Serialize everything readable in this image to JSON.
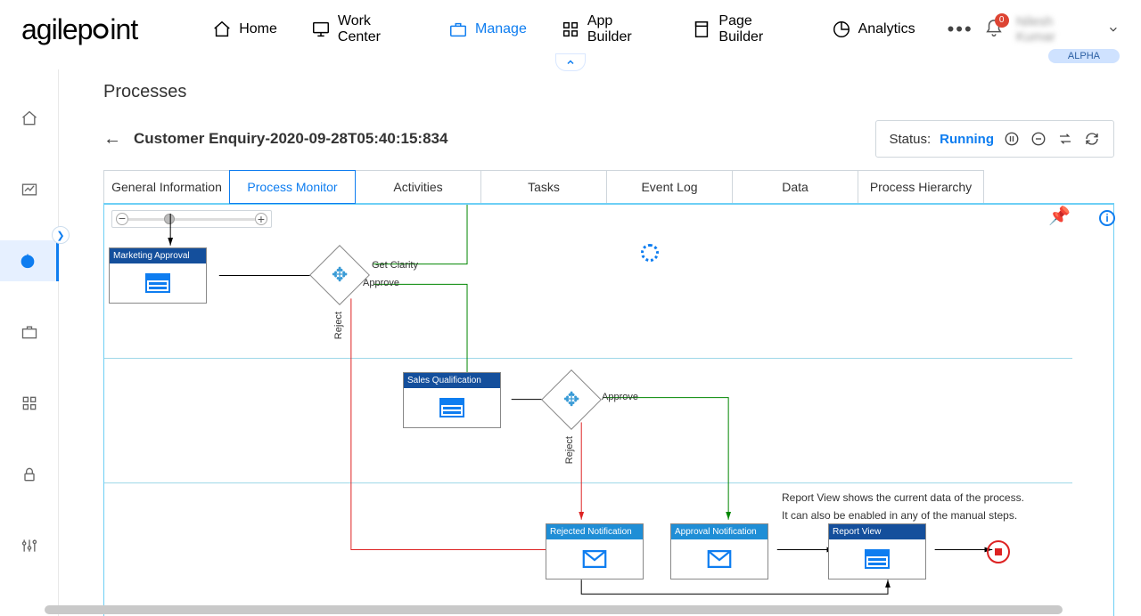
{
  "brand": "agilepoint",
  "alpha_badge": "ALPHA",
  "notif_count": "0",
  "user_name": "Nilesh Kumar",
  "nav": {
    "home": "Home",
    "work_center": "Work Center",
    "manage": "Manage",
    "app_builder": "App Builder",
    "page_builder": "Page Builder",
    "analytics": "Analytics"
  },
  "page": {
    "title": "Processes",
    "process_name": "Customer Enquiry-2020-09-28T05:40:15:834",
    "status_label": "Status:",
    "status_value": "Running"
  },
  "tabs": {
    "general": "General Information",
    "monitor": "Process Monitor",
    "activities": "Activities",
    "tasks": "Tasks",
    "eventlog": "Event Log",
    "data": "Data",
    "hierarchy": "Process Hierarchy"
  },
  "nodes": {
    "marketing": "Marketing Approval",
    "sales": "Sales Qualification",
    "rejected": "Rejected Notification",
    "approval": "Approval Notification",
    "report": "Report View"
  },
  "flow_labels": {
    "get_clarity": "Get Clarity",
    "approve1": "Approve",
    "reject1": "Reject",
    "approve2": "Approve",
    "reject2": "Reject"
  },
  "notes": {
    "line1": "Report View shows the current data of the process.",
    "line2": "It can also be enabled in any of the manual steps."
  },
  "zoom": {
    "minus": "−",
    "plus": "+"
  }
}
